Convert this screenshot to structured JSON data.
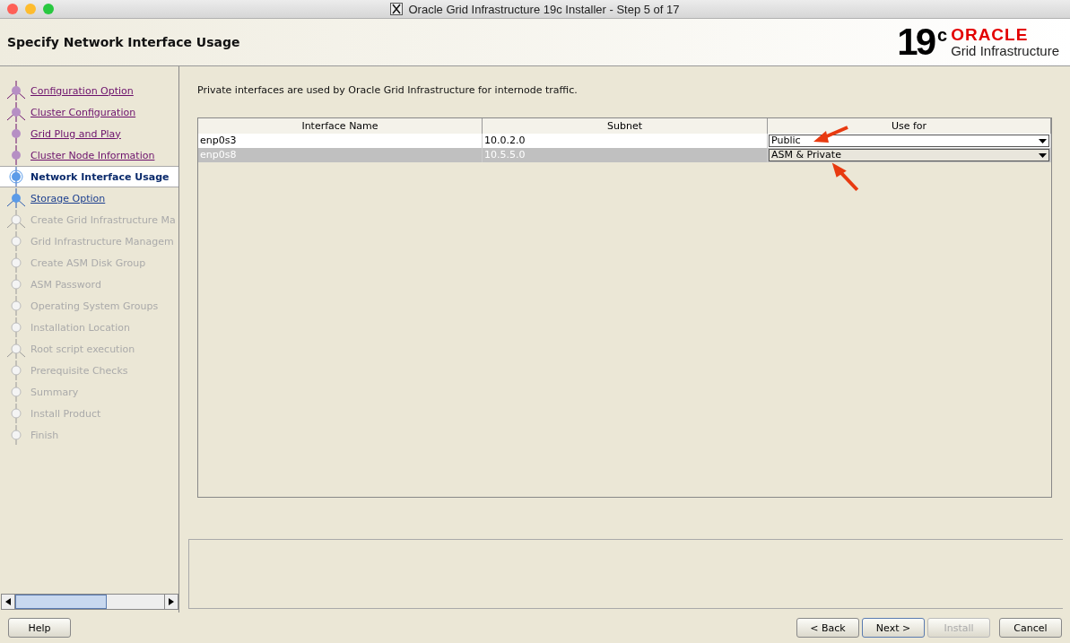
{
  "window": {
    "title": "Oracle Grid Infrastructure 19c Installer - Step 5 of 17"
  },
  "header": {
    "title": "Specify Network Interface Usage",
    "logo": {
      "version": "19",
      "superscript": "c",
      "brand": "ORACLE",
      "product": "Grid Infrastructure"
    }
  },
  "steps": [
    {
      "label": "Configuration Option",
      "visited": true,
      "selected": false,
      "disabled": false,
      "branch": true
    },
    {
      "label": "Cluster Configuration",
      "visited": true,
      "selected": false,
      "disabled": false,
      "branch": true
    },
    {
      "label": "Grid Plug and Play",
      "visited": true,
      "selected": false,
      "disabled": false,
      "branch": false
    },
    {
      "label": "Cluster Node Information",
      "visited": true,
      "selected": false,
      "disabled": false,
      "branch": false
    },
    {
      "label": "Network Interface Usage",
      "visited": false,
      "selected": true,
      "disabled": false,
      "branch": false
    },
    {
      "label": "Storage Option",
      "visited": false,
      "selected": false,
      "disabled": false,
      "branch": true
    },
    {
      "label": "Create Grid Infrastructure Ma",
      "visited": false,
      "selected": false,
      "disabled": true,
      "branch": true
    },
    {
      "label": "Grid Infrastructure Managem",
      "visited": false,
      "selected": false,
      "disabled": true,
      "branch": false
    },
    {
      "label": "Create ASM Disk Group",
      "visited": false,
      "selected": false,
      "disabled": true,
      "branch": false
    },
    {
      "label": "ASM Password",
      "visited": false,
      "selected": false,
      "disabled": true,
      "branch": false
    },
    {
      "label": "Operating System Groups",
      "visited": false,
      "selected": false,
      "disabled": true,
      "branch": false
    },
    {
      "label": "Installation Location",
      "visited": false,
      "selected": false,
      "disabled": true,
      "branch": false
    },
    {
      "label": "Root script execution",
      "visited": false,
      "selected": false,
      "disabled": true,
      "branch": true
    },
    {
      "label": "Prerequisite Checks",
      "visited": false,
      "selected": false,
      "disabled": true,
      "branch": false
    },
    {
      "label": "Summary",
      "visited": false,
      "selected": false,
      "disabled": true,
      "branch": false
    },
    {
      "label": "Install Product",
      "visited": false,
      "selected": false,
      "disabled": true,
      "branch": false
    },
    {
      "label": "Finish",
      "visited": false,
      "selected": false,
      "disabled": true,
      "branch": false
    }
  ],
  "intro": "Private interfaces are used by Oracle Grid Infrastructure for internode traffic.",
  "table": {
    "columns": [
      "Interface Name",
      "Subnet",
      "Use for"
    ],
    "rows": [
      {
        "name": "enp0s3",
        "subnet": "10.0.2.0",
        "use_for": "Public",
        "selected": false
      },
      {
        "name": "enp0s8",
        "subnet": "10.5.5.0",
        "use_for": "ASM & Private",
        "selected": true
      }
    ]
  },
  "buttons": [
    {
      "label": "Help",
      "disabled": false,
      "default": false
    },
    {
      "label": "< Back",
      "disabled": false,
      "default": false
    },
    {
      "label": "Next >",
      "disabled": false,
      "default": true
    },
    {
      "label": "Install",
      "disabled": true,
      "default": false
    },
    {
      "label": "Cancel",
      "disabled": false,
      "default": false
    }
  ]
}
